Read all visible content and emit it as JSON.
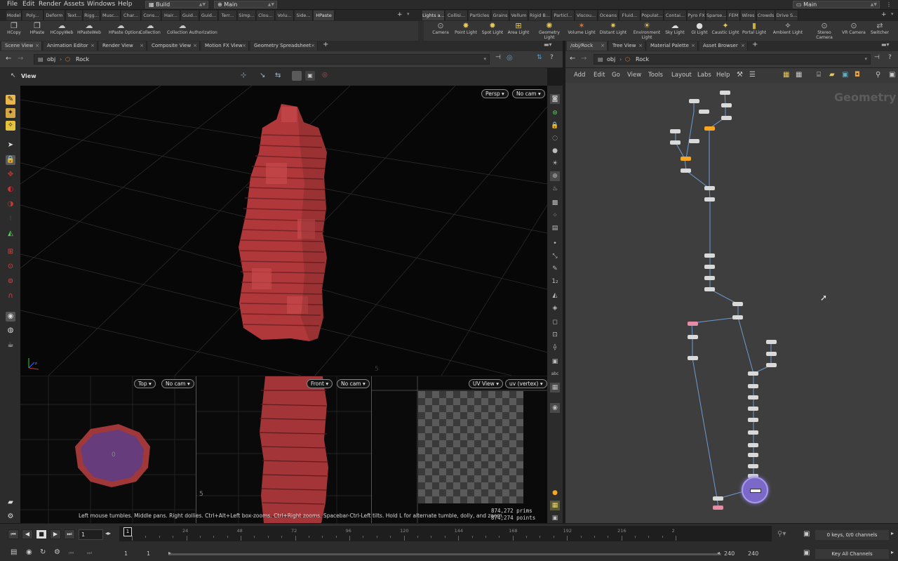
{
  "menubar": {
    "items": [
      "File",
      "Edit",
      "Render",
      "Assets",
      "Windows",
      "Help"
    ],
    "desktop": "Build",
    "context": "Main",
    "right_context": "Main"
  },
  "shelf_tabs_left": [
    "Model",
    "Poly...",
    "Deform",
    "Text...",
    "Rigg...",
    "Musc...",
    "Char...",
    "Cons...",
    "Hair...",
    "Guid...",
    "Guid...",
    "Terr...",
    "Simp...",
    "Clou...",
    "Volu...",
    "Side...",
    "HPaste"
  ],
  "shelf_tabs_right": [
    "Lights a...",
    "Collisi...",
    "Particles",
    "Grains",
    "Vellum",
    "Rigid B...",
    "Particl...",
    "Viscou...",
    "Oceans",
    "Fluid...",
    "Populat...",
    "Contai...",
    "Pyro FX",
    "Sparse...",
    "FEM",
    "Wires",
    "Crowds",
    "Drive S..."
  ],
  "shelf_tools_left": [
    {
      "label": "HCopy",
      "icon": "copy-icon"
    },
    {
      "label": "HPaste",
      "icon": "paste-icon"
    },
    {
      "label": "HCopyWeb",
      "icon": "cloud-icon"
    },
    {
      "label": "HPasteWeb",
      "icon": "cloud-icon"
    },
    {
      "label": "HPaste Options",
      "icon": "cloud-icon"
    },
    {
      "label": "Collection",
      "icon": "cloud-icon"
    },
    {
      "label": "Collection Authorization",
      "icon": "cloud-icon"
    }
  ],
  "shelf_tools_right": [
    {
      "label": "Camera"
    },
    {
      "label": "Point Light"
    },
    {
      "label": "Spot Light"
    },
    {
      "label": "Area Light"
    },
    {
      "label": "Geometry Light"
    },
    {
      "label": "Volume Light"
    },
    {
      "label": "Distant Light"
    },
    {
      "label": "Environment Light"
    },
    {
      "label": "Sky Light"
    },
    {
      "label": "GI Light"
    },
    {
      "label": "Caustic Light"
    },
    {
      "label": "Portal Light"
    },
    {
      "label": "Ambient Light"
    },
    {
      "label": "Stereo Camera"
    },
    {
      "label": "VR Camera"
    },
    {
      "label": "Switcher"
    }
  ],
  "left_pane_tabs": [
    "Scene View",
    "Animation Editor",
    "Render View",
    "Composite View",
    "Motion FX View",
    "Geometry Spreadsheet"
  ],
  "right_pane_tabs": [
    "/obj/Rock",
    "Tree View",
    "Material Palette",
    "Asset Browser"
  ],
  "left_path": {
    "level": "obj",
    "node": "Rock"
  },
  "right_path": {
    "level": "obj",
    "node": "Rock"
  },
  "viewport": {
    "title": "View",
    "camera_mode": "Persp",
    "camera": "No cam",
    "status": "Left mouse tumbles. Middle pans. Right dollies. Ctrl+Alt+Left box-zooms. Ctrl+Right zooms. Spacebar-Ctrl-Left tilts. Hold L for alternate tumble, dolly, and zoom.",
    "prims_count": "874,272",
    "prims_label": "prims",
    "points_count": "874,274",
    "points_label": "points"
  },
  "subviews": [
    {
      "mode": "Top",
      "camera": "No cam"
    },
    {
      "mode": "Front",
      "camera": "No cam"
    },
    {
      "mode": "UV View",
      "camera": "uv (vertex)"
    }
  ],
  "network": {
    "menu": [
      "Add",
      "Edit",
      "Go",
      "View",
      "Tools",
      "Layout",
      "Labs",
      "Help"
    ],
    "context_label": "Geometry"
  },
  "timeline": {
    "current_frame": "1",
    "start": "1",
    "start2": "1",
    "end": "240",
    "end2": "240",
    "ticks": [
      "24",
      "48",
      "72",
      "96",
      "120",
      "144",
      "168",
      "192",
      "216",
      "2"
    ],
    "keys_status": "0 keys, 0/0 channels",
    "key_mode": "Key All Channels"
  },
  "colors": {
    "rock": "#b0383a",
    "accent_orange": "#f5a623",
    "selection": "#7f6fc9"
  }
}
